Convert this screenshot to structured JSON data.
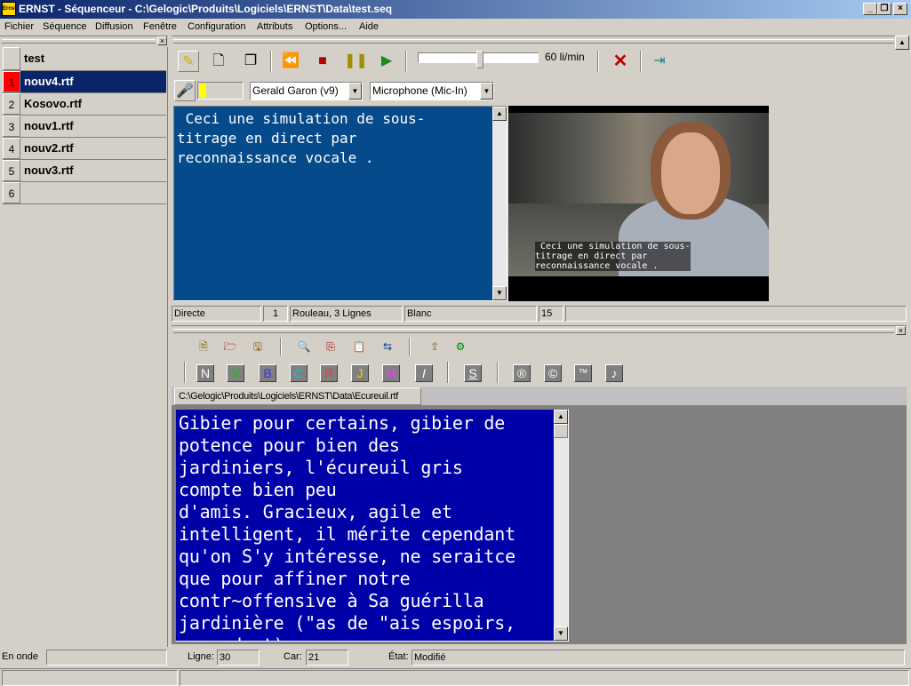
{
  "window": {
    "title": "ERNST - Séquenceur - C:\\Gelogic\\Produits\\Logiciels\\ERNST\\Data\\test.seq",
    "icon_text": "Ernst"
  },
  "menu": [
    "Fichier",
    "Séquence",
    "Diffusion",
    "Fenêtre",
    "Configuration",
    "Attributs",
    "Options...",
    "Aide"
  ],
  "list": {
    "header": "test",
    "items": [
      {
        "num": "1",
        "name": "nouv4.rtf"
      },
      {
        "num": "2",
        "name": "Kosovo.rtf"
      },
      {
        "num": "3",
        "name": "nouv1.rtf"
      },
      {
        "num": "4",
        "name": "nouv2.rtf"
      },
      {
        "num": "5",
        "name": "nouv3.rtf"
      },
      {
        "num": "6",
        "name": ""
      }
    ],
    "status": "En onde"
  },
  "toolbar": {
    "speed_label": "60 li/min"
  },
  "voice": {
    "speaker": "Gerald Garon (v9)",
    "input": "Microphone (Mic-In)"
  },
  "caption_text": " Ceci une simulation de sous-\ntitrage en direct par\nreconnaissance vocale .",
  "video_caption": " Ceci une simulation de sous-\ntitrage en direct par\nreconnaissance vocale .",
  "mid_status": {
    "mode": "Directe",
    "num": "1",
    "display": "Rouleau, 3 Lignes",
    "color": "Blanc",
    "count": "15"
  },
  "format_buttons": [
    "N",
    "V",
    "B",
    "C",
    "R",
    "J",
    "M",
    "I",
    "S",
    "®",
    "©",
    "™",
    "♪"
  ],
  "format_colors": [
    "#ffffff",
    "#00cc00",
    "#3333ff",
    "#00cccc",
    "#ff3333",
    "#ffcc00",
    "#ff33ff",
    "#ffffff",
    "#ffffff",
    "#ffffff",
    "#ffffff",
    "#ffffff",
    "#ffffff"
  ],
  "editor": {
    "tab": "C:\\Gelogic\\Produits\\Logiciels\\ERNST\\Data\\Ecureuil.rtf",
    "text": "Gibier pour certains, gibier de\npotence pour bien des\njardiniers, l'écureuil gris\ncompte bien peu\nd'amis. Gracieux, agile et\nintelligent, il mérite cependant\nqu'on S'y intéresse, ne seraitce\nque pour affiner notre\ncontr~offensive à Sa guérilla\njardinière (\"as de \"ais espoirs,\ncependant)"
  },
  "bottom_status": {
    "ligne_label": "Ligne:",
    "ligne": "30",
    "car_label": "Car:",
    "car": "21",
    "etat_label": "État:",
    "etat": "Modifié"
  }
}
